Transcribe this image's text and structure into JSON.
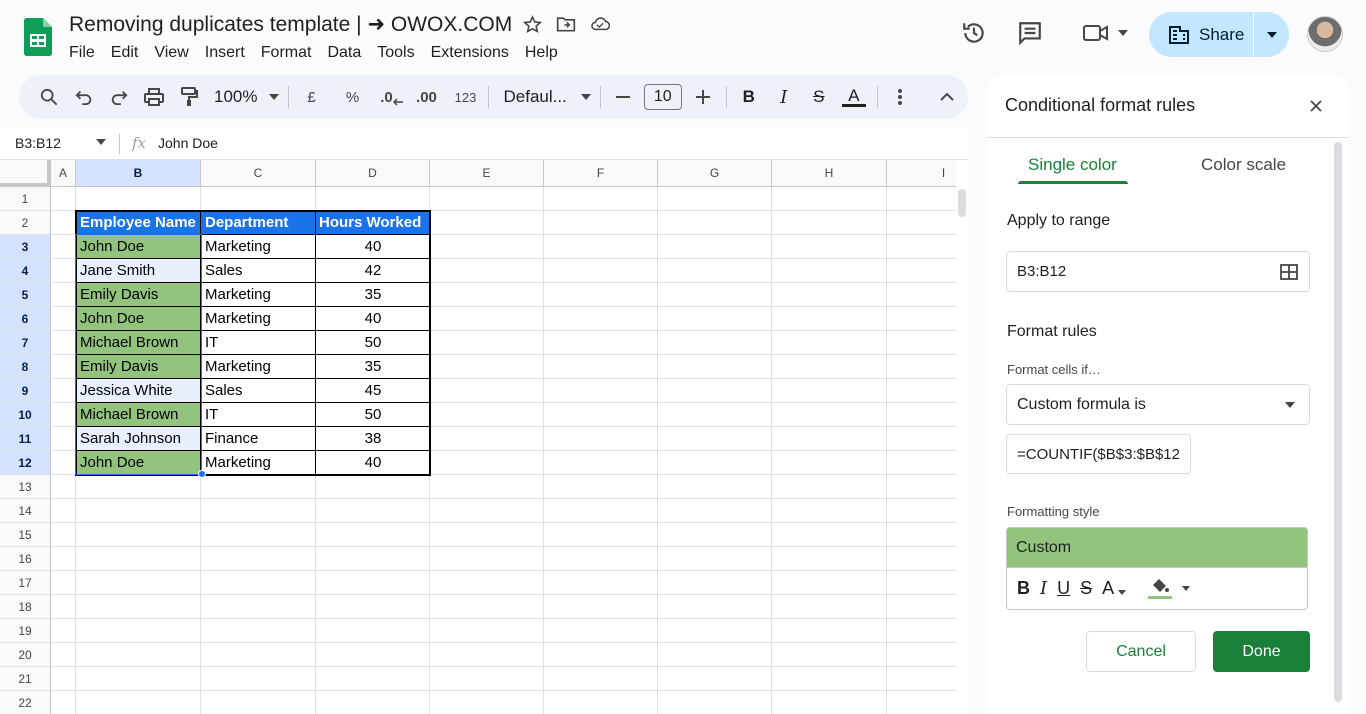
{
  "header": {
    "doc_title": "Removing duplicates template | ➜ OWOX.COM",
    "menu": [
      "File",
      "Edit",
      "View",
      "Insert",
      "Format",
      "Data",
      "Tools",
      "Extensions",
      "Help"
    ],
    "share_label": "Share"
  },
  "toolbar": {
    "zoom": "100%",
    "currency": "£",
    "percent": "%",
    "dec_decrease": ".0",
    "dec_increase": ".00",
    "number_format": "123",
    "font": "Defaul...",
    "font_size": "10"
  },
  "formula_bar": {
    "name_box": "B3:B12",
    "fx": "fx",
    "value": "John Doe"
  },
  "sheet": {
    "columns": [
      "A",
      "B",
      "C",
      "D",
      "E",
      "F",
      "G",
      "H",
      "I"
    ],
    "rows": [
      "1",
      "2",
      "3",
      "4",
      "5",
      "6",
      "7",
      "8",
      "9",
      "10",
      "11",
      "12",
      "13",
      "14",
      "15",
      "16",
      "17",
      "18",
      "19",
      "20",
      "21",
      "22"
    ],
    "table_headers": [
      "Employee Name",
      "Department",
      "Hours Worked"
    ],
    "table_rows": [
      {
        "name": "John Doe",
        "dept": "Marketing",
        "hours": "40",
        "duplicate": true
      },
      {
        "name": "Jane Smith",
        "dept": "Sales",
        "hours": "42",
        "duplicate": false
      },
      {
        "name": "Emily Davis",
        "dept": "Marketing",
        "hours": "35",
        "duplicate": true
      },
      {
        "name": "John Doe",
        "dept": "Marketing",
        "hours": "40",
        "duplicate": true
      },
      {
        "name": "Michael Brown",
        "dept": "IT",
        "hours": "50",
        "duplicate": true
      },
      {
        "name": "Emily Davis",
        "dept": "Marketing",
        "hours": "35",
        "duplicate": true
      },
      {
        "name": "Jessica White",
        "dept": "Sales",
        "hours": "45",
        "duplicate": false
      },
      {
        "name": "Michael Brown",
        "dept": "IT",
        "hours": "50",
        "duplicate": true
      },
      {
        "name": "Sarah Johnson",
        "dept": "Finance",
        "hours": "38",
        "duplicate": false
      },
      {
        "name": "John Doe",
        "dept": "Marketing",
        "hours": "40",
        "duplicate": true
      }
    ]
  },
  "panel": {
    "title": "Conditional format rules",
    "tab_single": "Single color",
    "tab_scale": "Color scale",
    "apply_label": "Apply to range",
    "range": "B3:B12",
    "format_rules_label": "Format rules",
    "format_if_label": "Format cells if…",
    "condition": "Custom formula is",
    "formula": "=COUNTIF($B$3:$B$12",
    "style_label": "Formatting style",
    "style_preview": "Custom",
    "cancel": "Cancel",
    "done": "Done"
  },
  "colors": {
    "header_blue": "#1a73e8",
    "duplicate_green": "#93c47d",
    "accent_green": "#188038",
    "share_bg": "#c2e7ff"
  }
}
